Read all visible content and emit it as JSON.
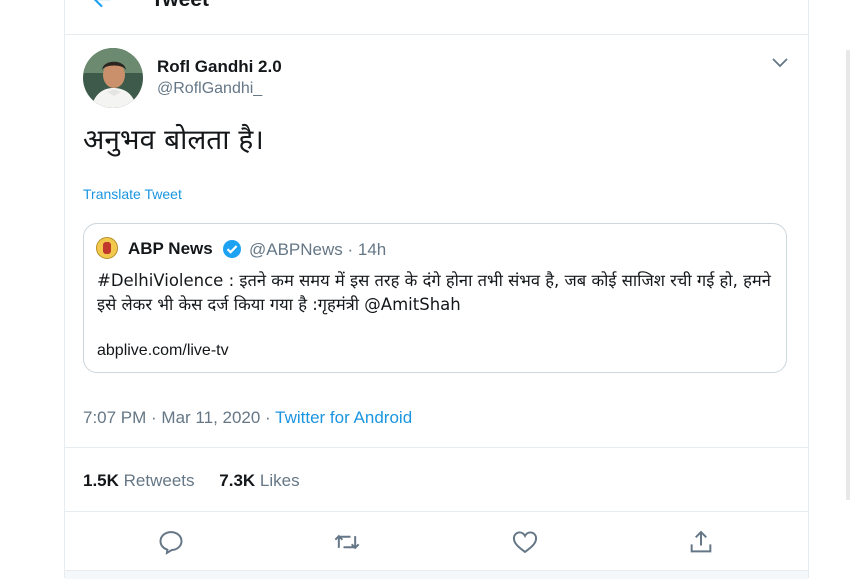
{
  "header": {
    "title": "Tweet"
  },
  "tweet": {
    "display_name": "Rofl Gandhi 2.0",
    "handle": "@RoflGandhi_",
    "text": "अनुभव बोलता है।",
    "translate_label": "Translate Tweet",
    "time": "7:07 PM · Mar 11, 2020 · ",
    "source": "Twitter for Android"
  },
  "quote": {
    "name": "ABP News",
    "handle_time": "@ABPNews · 14h",
    "text": "#DelhiViolence : इतने कम समय में इस तरह के दंगे होना तभी संभव है, जब कोई साजिश रची गई हो, हमने इसे लेकर भी केस दर्ज किया गया है :गृहमंत्री @AmitShah",
    "link": "abplive.com/live-tv"
  },
  "stats": {
    "retweets_count": "1.5K",
    "retweets_label": "Retweets",
    "likes_count": "7.3K",
    "likes_label": "Likes"
  },
  "icons": [
    "back-arrow-icon",
    "chevron-down-icon",
    "verified-icon",
    "reply-icon",
    "retweet-icon",
    "like-icon",
    "share-icon"
  ],
  "colors": {
    "accent": "#1b95e0",
    "secondary_text": "#657786",
    "border": "#e6ecf0"
  }
}
